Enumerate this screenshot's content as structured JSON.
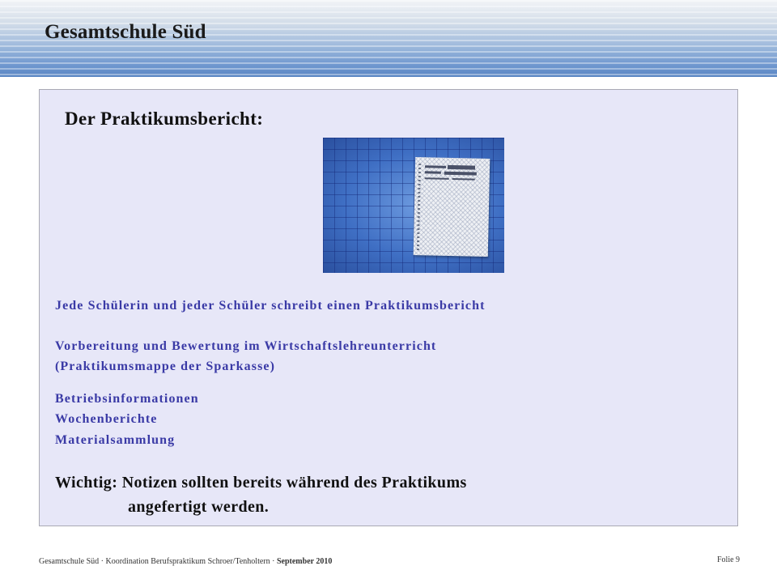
{
  "header": {
    "title": "Gesamtschule Süd"
  },
  "content": {
    "heading": "Der Praktikumsbericht:",
    "photo_icon": "praktikumsmappe-photo",
    "lines": [
      "Jede Schülerin und jeder Schüler schreibt einen Praktikumsbericht",
      "Vorbereitung und Bewertung im Wirtschaftslehreunterricht",
      "(Praktikumsmappe der Sparkasse)",
      "Betriebsinformationen",
      "Wochenberichte",
      "Materialsammlung"
    ],
    "note": {
      "label": "Wichtig:",
      "line1": "Notizen sollten bereits während des Praktikums",
      "line2": "angefertigt werden."
    }
  },
  "footer": {
    "left": "Gesamtschule Süd · Koordination Berufspraktikum Schroer/Tenholtern · ",
    "left_bold": "September 2010",
    "slide": "Folie 9"
  },
  "colors": {
    "banner_bottom": "#5a86c4",
    "content_background": "#e7e7f8",
    "list_text": "#3a3aa6",
    "note_text": "#111111"
  }
}
